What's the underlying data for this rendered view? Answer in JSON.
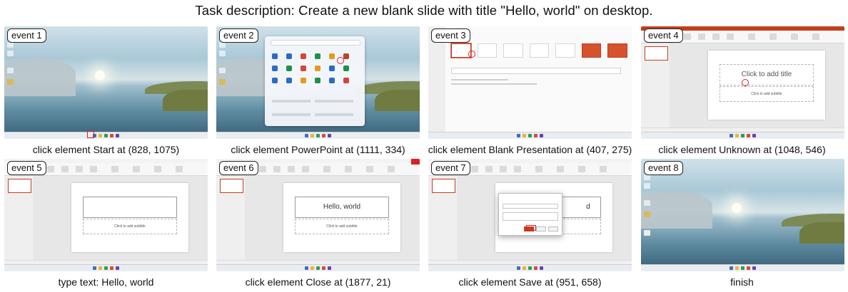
{
  "task_description": "Task description: Create a new blank slide with title \"Hello, world\" on desktop.",
  "events": [
    {
      "badge": "event 1",
      "caption": "click element Start at (828, 1075)",
      "screen": "desktop"
    },
    {
      "badge": "event 2",
      "caption": "click element PowerPoint at (1111, 334)",
      "screen": "start-menu"
    },
    {
      "badge": "event 3",
      "caption": "click element Blank Presentation at (407, 275)",
      "screen": "powerpoint-home"
    },
    {
      "badge": "event 4",
      "caption": "click element Unknown at (1048, 546)",
      "screen": "blank-slide"
    },
    {
      "badge": "event 5",
      "caption": "type text: Hello, world",
      "screen": "title-editing"
    },
    {
      "badge": "event 6",
      "caption": "click element Close at (1877, 21)",
      "screen": "title-typed"
    },
    {
      "badge": "event 7",
      "caption": "click element Save at (951, 658)",
      "screen": "save-dialog"
    },
    {
      "badge": "event 8",
      "caption": "finish",
      "screen": "desktop"
    }
  ],
  "slide_text": {
    "title_placeholder": "Click to add title",
    "subtitle_placeholder": "Click to add subtitle",
    "typed_title": "Hello, world"
  },
  "colors": {
    "accent": "#c43e1c",
    "cursor": "#e02020"
  }
}
